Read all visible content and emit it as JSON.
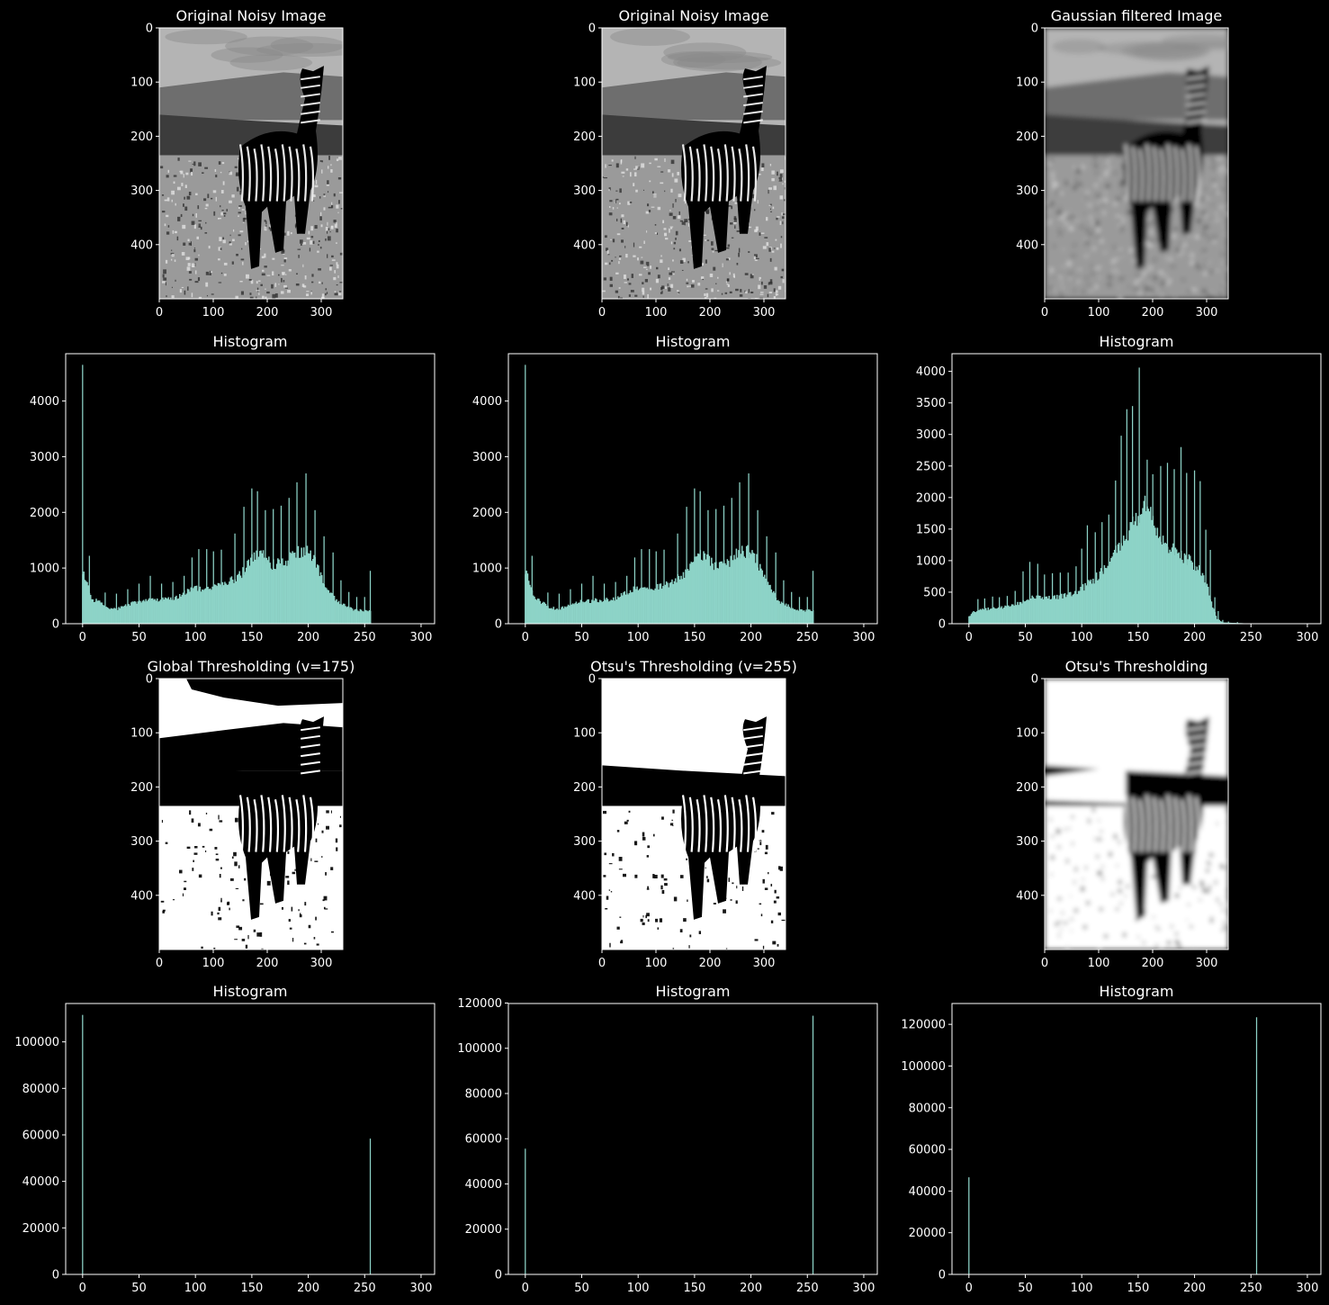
{
  "figure": {
    "background": "#000000",
    "foreground": "#ffffff",
    "bar_color": "#8dd3c7"
  },
  "chart_data": [
    {
      "type": "image",
      "title": "Original Noisy Image",
      "image": "zebra-grayscale-noisy",
      "xlim": [
        0,
        340
      ],
      "ylim": [
        500,
        0
      ],
      "xticks": [
        0,
        100,
        200,
        300
      ],
      "yticks": [
        0,
        100,
        200,
        300,
        400
      ]
    },
    {
      "type": "image",
      "title": "Original Noisy Image",
      "image": "zebra-grayscale-noisy",
      "xlim": [
        0,
        340
      ],
      "ylim": [
        500,
        0
      ],
      "xticks": [
        0,
        100,
        200,
        300
      ],
      "yticks": [
        0,
        100,
        200,
        300,
        400
      ]
    },
    {
      "type": "image",
      "title": "Gaussian filtered Image",
      "image": "zebra-grayscale-gaussian-blurred",
      "xlim": [
        0,
        340
      ],
      "ylim": [
        500,
        0
      ],
      "xticks": [
        0,
        100,
        200,
        300
      ],
      "yticks": [
        0,
        100,
        200,
        300,
        400
      ]
    },
    {
      "type": "bar",
      "title": "Histogram",
      "xlim": [
        -15,
        312
      ],
      "ylim": [
        0,
        4850
      ],
      "xticks": [
        0,
        50,
        100,
        150,
        200,
        250,
        300
      ],
      "yticks": [
        0,
        1000,
        2000,
        3000,
        4000
      ],
      "envelope": [
        [
          0,
          900
        ],
        [
          3,
          800
        ],
        [
          8,
          450
        ],
        [
          15,
          380
        ],
        [
          20,
          300
        ],
        [
          30,
          260
        ],
        [
          45,
          380
        ],
        [
          60,
          420
        ],
        [
          80,
          440
        ],
        [
          95,
          620
        ],
        [
          110,
          640
        ],
        [
          125,
          700
        ],
        [
          140,
          880
        ],
        [
          150,
          1150
        ],
        [
          158,
          1250
        ],
        [
          168,
          1050
        ],
        [
          180,
          1100
        ],
        [
          190,
          1280
        ],
        [
          198,
          1300
        ],
        [
          205,
          1150
        ],
        [
          215,
          700
        ],
        [
          225,
          400
        ],
        [
          240,
          250
        ],
        [
          255,
          230
        ]
      ],
      "spikes": [
        [
          0,
          4650
        ],
        [
          6,
          1220
        ],
        [
          20,
          560
        ],
        [
          30,
          540
        ],
        [
          40,
          620
        ],
        [
          50,
          720
        ],
        [
          60,
          860
        ],
        [
          70,
          720
        ],
        [
          80,
          750
        ],
        [
          90,
          860
        ],
        [
          97,
          1190
        ],
        [
          103,
          1340
        ],
        [
          110,
          1340
        ],
        [
          116,
          1300
        ],
        [
          123,
          1330
        ],
        [
          135,
          1620
        ],
        [
          143,
          2100
        ],
        [
          150,
          2430
        ],
        [
          155,
          2380
        ],
        [
          162,
          2040
        ],
        [
          169,
          2060
        ],
        [
          176,
          2120
        ],
        [
          183,
          2260
        ],
        [
          190,
          2540
        ],
        [
          198,
          2700
        ],
        [
          206,
          2040
        ],
        [
          214,
          1570
        ],
        [
          222,
          1280
        ],
        [
          229,
          780
        ],
        [
          236,
          570
        ],
        [
          243,
          480
        ],
        [
          250,
          480
        ],
        [
          255,
          950
        ]
      ]
    },
    {
      "type": "bar",
      "title": "Histogram",
      "xlim": [
        -15,
        312
      ],
      "ylim": [
        0,
        4850
      ],
      "xticks": [
        0,
        50,
        100,
        150,
        200,
        250,
        300
      ],
      "yticks": [
        0,
        1000,
        2000,
        3000,
        4000
      ],
      "envelope": [
        [
          0,
          900
        ],
        [
          3,
          800
        ],
        [
          8,
          450
        ],
        [
          15,
          380
        ],
        [
          20,
          300
        ],
        [
          30,
          260
        ],
        [
          45,
          380
        ],
        [
          60,
          420
        ],
        [
          80,
          440
        ],
        [
          95,
          620
        ],
        [
          110,
          640
        ],
        [
          125,
          700
        ],
        [
          140,
          880
        ],
        [
          150,
          1150
        ],
        [
          158,
          1250
        ],
        [
          168,
          1050
        ],
        [
          180,
          1100
        ],
        [
          190,
          1280
        ],
        [
          198,
          1300
        ],
        [
          205,
          1150
        ],
        [
          215,
          700
        ],
        [
          225,
          400
        ],
        [
          240,
          250
        ],
        [
          255,
          230
        ]
      ],
      "spikes": [
        [
          0,
          4650
        ],
        [
          6,
          1220
        ],
        [
          20,
          560
        ],
        [
          30,
          540
        ],
        [
          40,
          620
        ],
        [
          50,
          720
        ],
        [
          60,
          860
        ],
        [
          70,
          720
        ],
        [
          80,
          750
        ],
        [
          90,
          860
        ],
        [
          97,
          1190
        ],
        [
          103,
          1340
        ],
        [
          110,
          1340
        ],
        [
          116,
          1300
        ],
        [
          123,
          1330
        ],
        [
          135,
          1620
        ],
        [
          143,
          2100
        ],
        [
          150,
          2430
        ],
        [
          155,
          2380
        ],
        [
          162,
          2040
        ],
        [
          169,
          2060
        ],
        [
          176,
          2120
        ],
        [
          183,
          2260
        ],
        [
          190,
          2540
        ],
        [
          198,
          2700
        ],
        [
          206,
          2040
        ],
        [
          214,
          1570
        ],
        [
          222,
          1280
        ],
        [
          229,
          780
        ],
        [
          236,
          570
        ],
        [
          243,
          480
        ],
        [
          250,
          480
        ],
        [
          255,
          950
        ]
      ]
    },
    {
      "type": "bar",
      "title": "Histogram",
      "xlim": [
        -15,
        312
      ],
      "ylim": [
        0,
        4280
      ],
      "xticks": [
        0,
        50,
        100,
        150,
        200,
        250,
        300
      ],
      "yticks": [
        0,
        500,
        1000,
        1500,
        2000,
        2500,
        3000,
        3500,
        4000
      ],
      "envelope": [
        [
          0,
          120
        ],
        [
          5,
          200
        ],
        [
          15,
          230
        ],
        [
          30,
          260
        ],
        [
          45,
          330
        ],
        [
          55,
          420
        ],
        [
          70,
          400
        ],
        [
          90,
          460
        ],
        [
          100,
          560
        ],
        [
          110,
          680
        ],
        [
          120,
          880
        ],
        [
          130,
          1130
        ],
        [
          140,
          1420
        ],
        [
          148,
          1650
        ],
        [
          155,
          1880
        ],
        [
          160,
          1750
        ],
        [
          165,
          1450
        ],
        [
          175,
          1250
        ],
        [
          185,
          1100
        ],
        [
          195,
          1000
        ],
        [
          205,
          850
        ],
        [
          212,
          550
        ],
        [
          216,
          280
        ],
        [
          220,
          80
        ],
        [
          225,
          20
        ],
        [
          240,
          10
        ],
        [
          256,
          0
        ]
      ],
      "spikes": [
        [
          3,
          180
        ],
        [
          8,
          390
        ],
        [
          14,
          400
        ],
        [
          21,
          430
        ],
        [
          27,
          420
        ],
        [
          34,
          440
        ],
        [
          41,
          520
        ],
        [
          48,
          830
        ],
        [
          54,
          980
        ],
        [
          61,
          950
        ],
        [
          67,
          780
        ],
        [
          74,
          800
        ],
        [
          81,
          810
        ],
        [
          88,
          810
        ],
        [
          95,
          910
        ],
        [
          100,
          1190
        ],
        [
          105,
          1560
        ],
        [
          112,
          1450
        ],
        [
          118,
          1610
        ],
        [
          124,
          1730
        ],
        [
          130,
          2270
        ],
        [
          135,
          2980
        ],
        [
          140,
          3400
        ],
        [
          145,
          3450
        ],
        [
          151,
          4060
        ],
        [
          158,
          2600
        ],
        [
          163,
          2370
        ],
        [
          170,
          2500
        ],
        [
          176,
          2550
        ],
        [
          182,
          2450
        ],
        [
          188,
          2800
        ],
        [
          193,
          2390
        ],
        [
          200,
          2430
        ],
        [
          205,
          2260
        ],
        [
          210,
          1490
        ],
        [
          214,
          1170
        ],
        [
          218,
          420
        ],
        [
          221,
          200
        ],
        [
          225,
          60
        ],
        [
          230,
          35
        ],
        [
          238,
          25
        ]
      ]
    },
    {
      "type": "image",
      "title": "Global Thresholding (v=175)",
      "image": "zebra-binary-threshold-175",
      "xlim": [
        0,
        340
      ],
      "ylim": [
        500,
        0
      ],
      "xticks": [
        0,
        100,
        200,
        300
      ],
      "yticks": [
        0,
        100,
        200,
        300,
        400
      ]
    },
    {
      "type": "image",
      "title": "Otsu's Thresholding (v=255)",
      "image": "zebra-binary-otsu",
      "xlim": [
        0,
        340
      ],
      "ylim": [
        500,
        0
      ],
      "xticks": [
        0,
        100,
        200,
        300
      ],
      "yticks": [
        0,
        100,
        200,
        300,
        400
      ]
    },
    {
      "type": "image",
      "title": "Otsu's Thresholding",
      "image": "zebra-binary-otsu-blurred",
      "xlim": [
        0,
        340
      ],
      "ylim": [
        500,
        0
      ],
      "xticks": [
        0,
        100,
        200,
        300
      ],
      "yticks": [
        0,
        100,
        200,
        300,
        400
      ]
    },
    {
      "type": "bar",
      "title": "Histogram",
      "xlim": [
        -15,
        312
      ],
      "ylim": [
        0,
        116500
      ],
      "xticks": [
        0,
        50,
        100,
        150,
        200,
        250,
        300
      ],
      "yticks": [
        0,
        20000,
        40000,
        60000,
        80000,
        100000
      ],
      "spikes": [
        [
          0,
          111600
        ],
        [
          255,
          58400
        ]
      ]
    },
    {
      "type": "bar",
      "title": "Histogram",
      "xlim": [
        -15,
        312
      ],
      "ylim": [
        0,
        119800
      ],
      "xticks": [
        0,
        50,
        100,
        150,
        200,
        250,
        300
      ],
      "yticks": [
        0,
        20000,
        40000,
        60000,
        80000,
        100000,
        120000
      ],
      "spikes": [
        [
          0,
          55600
        ],
        [
          255,
          114400
        ]
      ]
    },
    {
      "type": "bar",
      "title": "Histogram",
      "xlim": [
        -15,
        312
      ],
      "ylim": [
        0,
        130000
      ],
      "xticks": [
        0,
        50,
        100,
        150,
        200,
        250,
        300
      ],
      "yticks": [
        0,
        20000,
        40000,
        60000,
        80000,
        100000,
        120000
      ],
      "spikes": [
        [
          0,
          46600
        ],
        [
          255,
          123400
        ]
      ]
    }
  ]
}
